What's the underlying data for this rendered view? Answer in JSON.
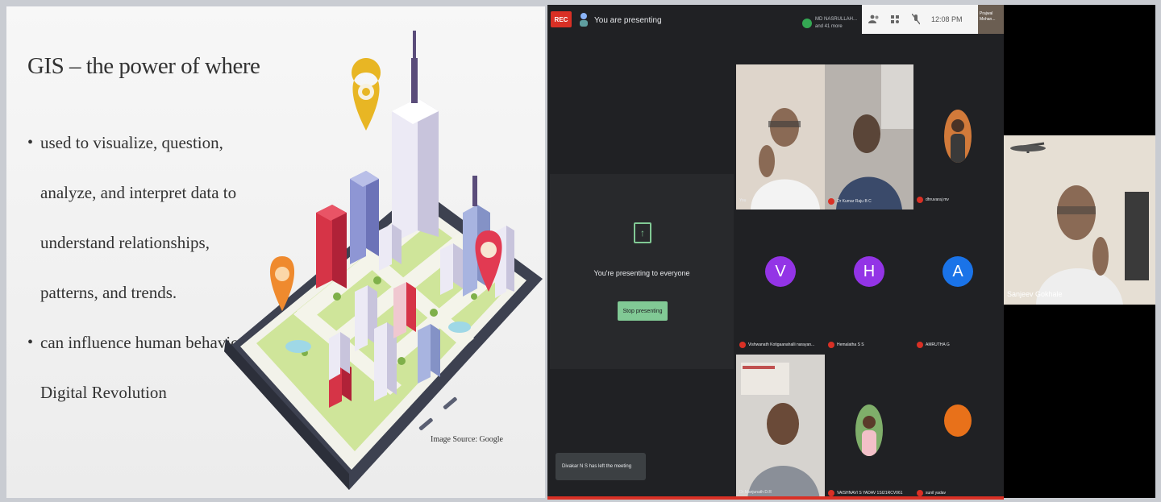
{
  "slide": {
    "title": "GIS – the power of where",
    "bullets": [
      "used to visualize, question, analyze, and interpret data to understand relationships, patterns, and trends.",
      "can influence human behavior – Digital Revolution"
    ],
    "image_source": "Image Source: Google"
  },
  "meet": {
    "rec_label": "REC",
    "presenting_status": "You are presenting",
    "top_chip_names": "MD NASRULLAH... and 41 more",
    "clock": "12:08 PM",
    "top_thumb_name": "Prajwal Mohan...",
    "presenting_message": "You're presenting to everyone",
    "stop_button": "Stop presenting",
    "toast": "Divakar N S has left the meeting",
    "participants": [
      {
        "name": "You",
        "type": "video"
      },
      {
        "name": "Dr Kumar Raju B C",
        "type": "video"
      },
      {
        "name": "dhruvaraj mv",
        "type": "photo"
      },
      {
        "name": "Vishwanath Kotigaanahalli narayan...",
        "type": "letter",
        "letter": "V",
        "color": "#9334e6"
      },
      {
        "name": "Hemalatha S S",
        "type": "letter",
        "letter": "H",
        "color": "#9334e6"
      },
      {
        "name": "AMRUTHA G",
        "type": "letter",
        "letter": "A",
        "color": "#1a73e8"
      },
      {
        "name": "Dr Manjunath D.R",
        "type": "video"
      },
      {
        "name": "VAISHNAVI S YADAV 1SI21RCV061",
        "type": "photo"
      },
      {
        "name": "sunil yadav",
        "type": "color",
        "color": "#e8711a"
      }
    ],
    "self_name": "Sanjeev Gokhale"
  }
}
